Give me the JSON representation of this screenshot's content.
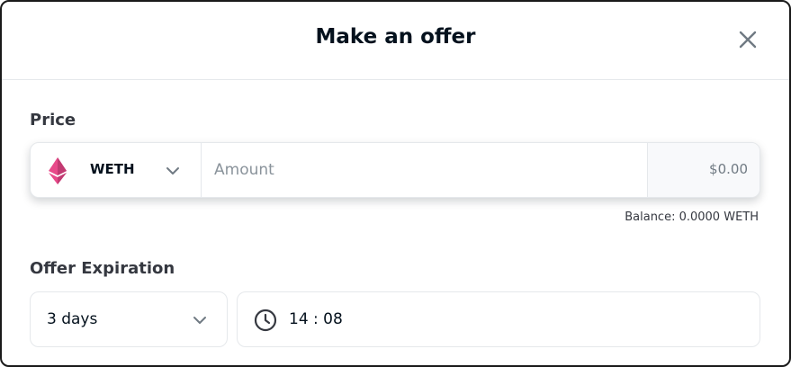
{
  "modal": {
    "title": "Make an offer",
    "close_icon": "close-icon"
  },
  "price": {
    "label": "Price",
    "currency": "WETH",
    "currency_icon": "ethereum-icon",
    "amount_placeholder": "Amount",
    "amount_value": "",
    "usd_value": "$0.00",
    "balance": "Balance: 0.0000 WETH"
  },
  "expiration": {
    "label": "Offer Expiration",
    "duration": "3 days",
    "time": "14 : 08",
    "time_icon": "clock-icon"
  },
  "colors": {
    "eth_pink": "#e84a8a",
    "text_primary": "#04111d",
    "text_muted": "#707a83",
    "border": "#e5e8eb"
  }
}
